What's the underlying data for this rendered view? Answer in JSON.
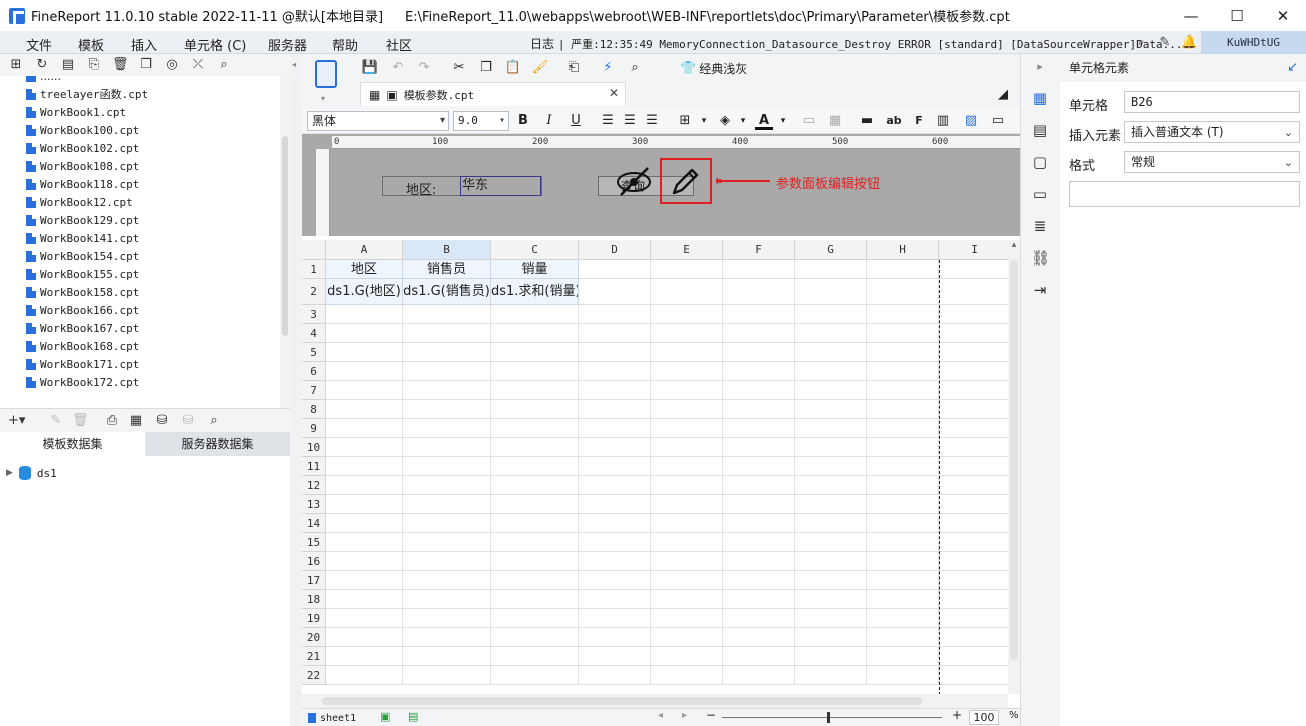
{
  "window": {
    "app_title": "FineReport 11.0.10 stable 2022-11-11 @默认[本地目录]",
    "file_path": "E:\\FineReport_11.0\\webapps\\webroot\\WEB-INF\\reportlets\\doc\\Primary\\Parameter\\模板参数.cpt",
    "minimize": "—",
    "maximize": "☐",
    "close": "✕"
  },
  "menu": {
    "items": [
      "文件",
      "模板",
      "插入",
      "单元格 (C)",
      "服务器",
      "帮助",
      "社区"
    ],
    "log_label": "日志",
    "log_message": "| 严重:12:35:49 MemoryConnection_Datasource_Destroy ERROR [standard] [DataSourceWrapper]Data...",
    "user": "KuWHDtUG"
  },
  "left_panel": {
    "files": [
      "treelayer函数.cpt",
      "WorkBook1.cpt",
      "WorkBook100.cpt",
      "WorkBook102.cpt",
      "WorkBook108.cpt",
      "WorkBook118.cpt",
      "WorkBook12.cpt",
      "WorkBook129.cpt",
      "WorkBook141.cpt",
      "WorkBook154.cpt",
      "WorkBook155.cpt",
      "WorkBook158.cpt",
      "WorkBook166.cpt",
      "WorkBook167.cpt",
      "WorkBook168.cpt",
      "WorkBook171.cpt",
      "WorkBook172.cpt"
    ],
    "tabs": [
      "模板数据集",
      "服务器数据集"
    ],
    "dataset": "ds1"
  },
  "editor": {
    "doc_tab": "模板参数.cpt",
    "style_button": "经典浅灰",
    "font_name": "黑体",
    "font_size": "9.0",
    "ruler_ticks": [
      "0",
      "100",
      "200",
      "300",
      "400",
      "500",
      "600"
    ],
    "param_label": "地区:",
    "param_value": "华东",
    "query_button": "查询",
    "annotation": "参数面板编辑按钮",
    "annotation_color": "#e02020",
    "columns": [
      "A",
      "B",
      "C",
      "D",
      "E",
      "F",
      "G",
      "H",
      "I"
    ],
    "rows": [
      "1",
      "2",
      "3",
      "4",
      "5",
      "6",
      "7",
      "8",
      "9",
      "10",
      "11",
      "12",
      "13",
      "14",
      "15",
      "16",
      "17",
      "18",
      "19",
      "20",
      "21",
      "22"
    ],
    "cells": {
      "A1": "地区",
      "B1": "销售员",
      "C1": "销量",
      "A2": "ds1.G(地区)",
      "B2": "ds1.G(销售员)",
      "C2": "ds1.求和(销量)"
    },
    "sheet_tab": "sheet1",
    "zoom": "100",
    "zoom_unit": "%"
  },
  "right_panel": {
    "title": "单元格元素",
    "cell_label": "单元格",
    "cell_value": "B26",
    "insert_label": "插入元素",
    "insert_value": "插入普通文本 (T)",
    "format_label": "格式",
    "format_value": "常规"
  }
}
